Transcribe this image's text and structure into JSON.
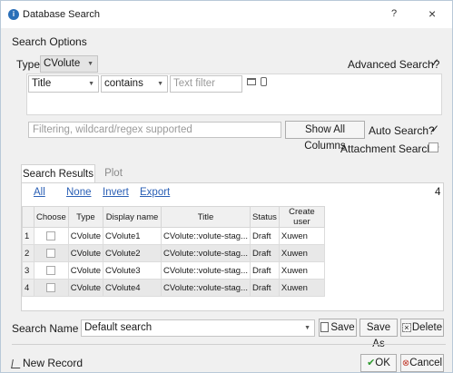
{
  "window": {
    "title": "Database Search",
    "help": "?",
    "close": "×"
  },
  "search_options": {
    "section_title": "Search Options",
    "type_label": "Type",
    "type_value": "CVolute",
    "advanced_label": "Advanced Search?",
    "advanced_checked": "✓",
    "field_value": "Title",
    "operator_value": "contains",
    "text_filter_placeholder": "Text filter",
    "filter_placeholder": "Filtering, wildcard/regex supported",
    "show_all_columns": "Show All Columns",
    "auto_search_label": "Auto Search?",
    "auto_search_checked": "✓",
    "attachment_label": "Attachment Search?"
  },
  "tabs": [
    {
      "label": "Search Results"
    },
    {
      "label": "Plot"
    }
  ],
  "results": {
    "links": [
      "All",
      "None",
      "Invert",
      "Export"
    ],
    "count": "4",
    "columns": [
      "Choose",
      "Type",
      "Display name",
      "Title",
      "Status",
      "Create user"
    ],
    "rows": [
      {
        "n": "1",
        "type": "CVolute",
        "name": "CVolute1",
        "title": "CVolute::volute-stag...",
        "status": "Draft",
        "user": "Xuwen"
      },
      {
        "n": "2",
        "type": "CVolute",
        "name": "CVolute2",
        "title": "CVolute::volute-stag...",
        "status": "Draft",
        "user": "Xuwen"
      },
      {
        "n": "3",
        "type": "CVolute",
        "name": "CVolute3",
        "title": "CVolute::volute-stag...",
        "status": "Draft",
        "user": "Xuwen"
      },
      {
        "n": "4",
        "type": "CVolute",
        "name": "CVolute4",
        "title": "CVolute::volute-stag...",
        "status": "Draft",
        "user": "Xuwen"
      }
    ]
  },
  "search_name": {
    "label": "Search Name",
    "value": "Default search",
    "save": "Save",
    "save_as": "Save As",
    "delete": "Delete"
  },
  "footer": {
    "new_record": "New Record",
    "ok": "OK",
    "cancel": "Cancel"
  },
  "colors": {
    "accent": "#2a5fb5",
    "ok_check": "#2e9a2e",
    "cancel_icon": "#c0392b"
  }
}
